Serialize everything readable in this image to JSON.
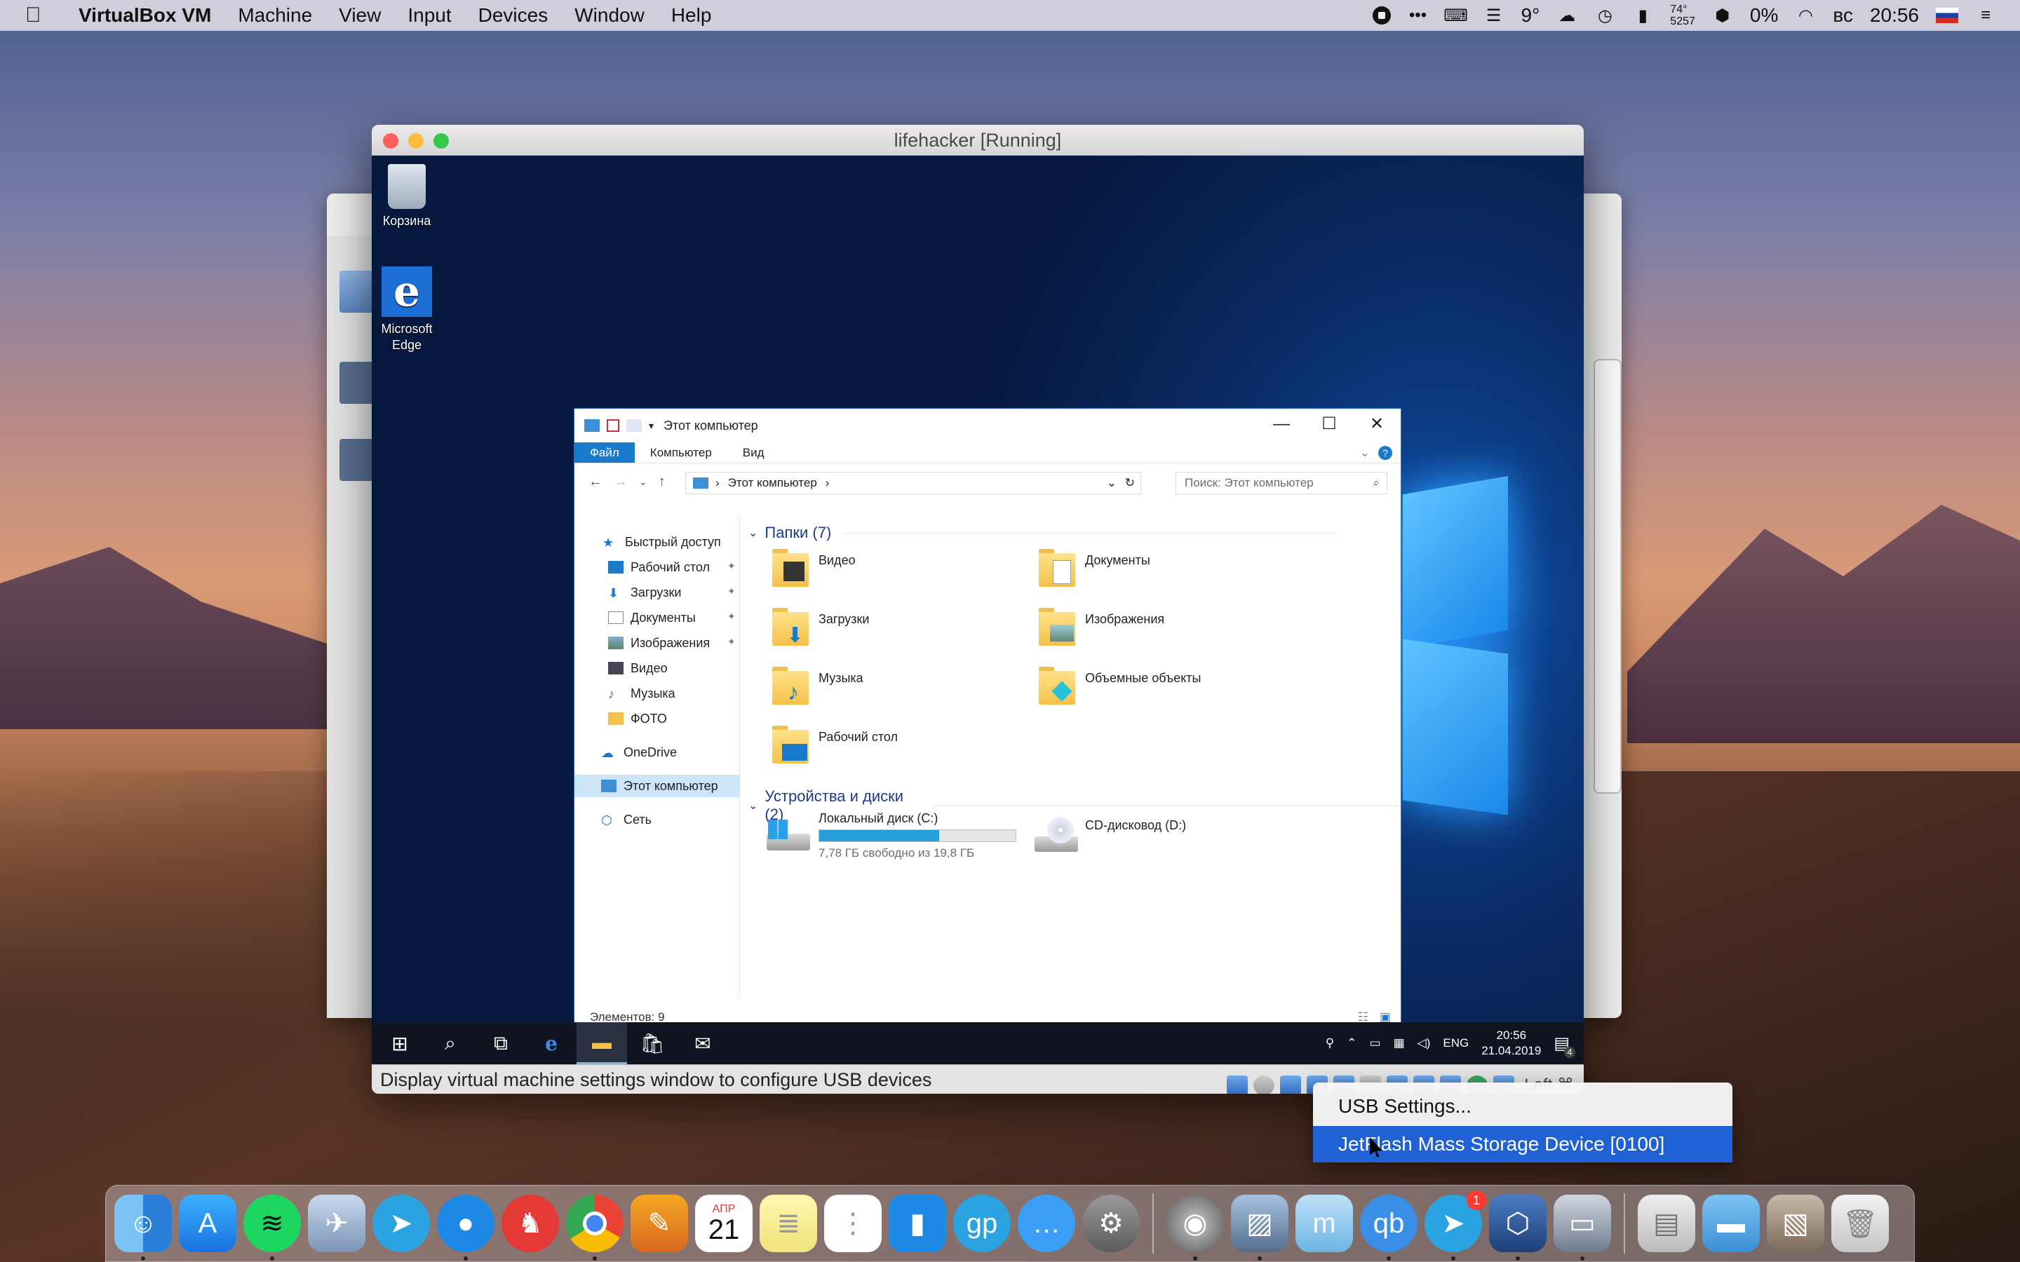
{
  "menubar": {
    "app": "VirtualBox VM",
    "menus": [
      "Machine",
      "View",
      "Input",
      "Devices",
      "Window",
      "Help"
    ],
    "weather_temp": "9°",
    "battery_top": "74°",
    "battery_bottom": "5257",
    "vpn_percent": "0%",
    "day": "вс",
    "time": "20:56"
  },
  "vm": {
    "title": "lifehacker [Running]",
    "status": "Display virtual machine settings window to configure USB devices",
    "host_key": "Left ⌘"
  },
  "desktop": {
    "icons": [
      {
        "label": "Корзина"
      },
      {
        "label_line1": "Microsoft",
        "label_line2": "Edge"
      }
    ]
  },
  "explorer": {
    "title": "Этот компьютер",
    "tabs": [
      "Файл",
      "Компьютер",
      "Вид"
    ],
    "address": "Этот компьютер",
    "search_placeholder": "Поиск: Этот компьютер",
    "nav": [
      {
        "label": "Быстрый доступ"
      },
      {
        "label": "Рабочий стол"
      },
      {
        "label": "Загрузки"
      },
      {
        "label": "Документы"
      },
      {
        "label": "Изображения"
      },
      {
        "label": "Видео"
      },
      {
        "label": "Музыка"
      },
      {
        "label": "ФОТО"
      },
      {
        "label": "OneDrive"
      },
      {
        "label": "Этот компьютер"
      },
      {
        "label": "Сеть"
      }
    ],
    "folders_header": "Папки (7)",
    "folders": [
      "Видео",
      "Документы",
      "Загрузки",
      "Изображения",
      "Музыка",
      "Объемные объекты",
      "Рабочий стол"
    ],
    "devices_header": "Устройства и диски (2)",
    "disk_c": {
      "name": "Локальный диск (C:)",
      "free": "7,78 ГБ свободно из 19,8 ГБ",
      "used_fraction": 0.61
    },
    "disk_d": {
      "name": "CD-дисковод (D:)"
    },
    "status": "Элементов: 9"
  },
  "taskbar": {
    "lang": "ENG",
    "time": "20:56",
    "date": "21.04.2019",
    "notif_count": "4"
  },
  "context_menu": {
    "items": [
      "USB Settings...",
      "JetFlash Mass Storage Device [0100]"
    ]
  },
  "dock": {
    "calendar_month": "АПР",
    "calendar_day": "21",
    "telegram_badge": "1"
  }
}
